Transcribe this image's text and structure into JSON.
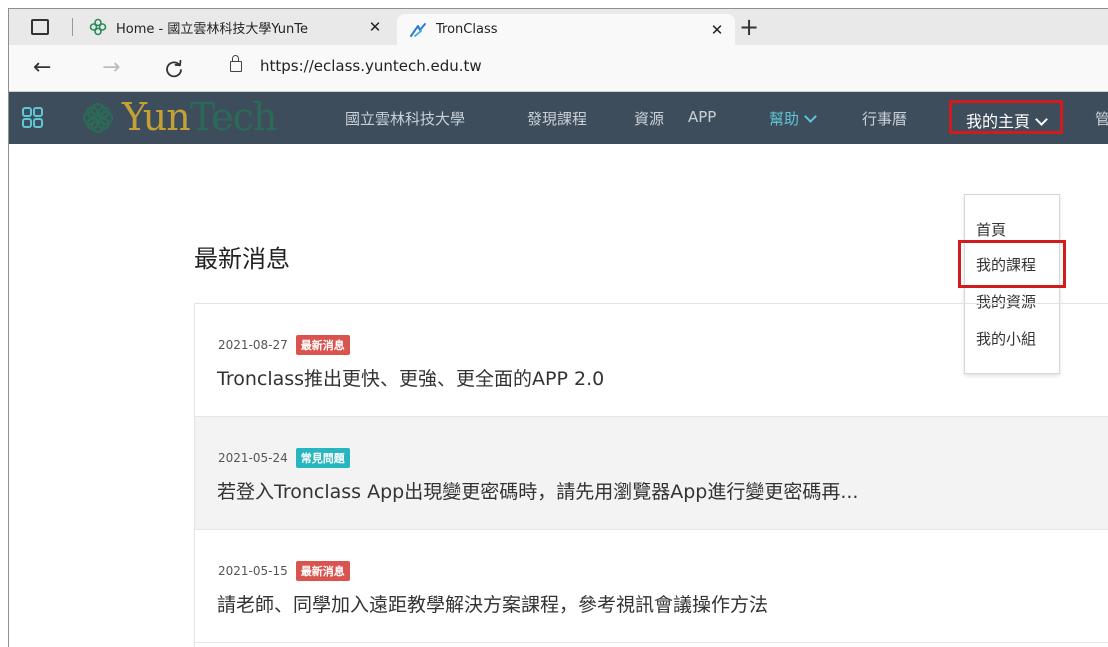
{
  "browser": {
    "tabs": [
      {
        "title": "Home - 國立雲林科技大學YunTe",
        "close": "✕"
      },
      {
        "title": "TronClass",
        "close": "✕"
      }
    ],
    "new_tab": "+",
    "url": "https://eclass.yuntech.edu.tw",
    "icons": {
      "back": "←",
      "forward": "→",
      "reload": "C"
    }
  },
  "site": {
    "logo_yun": "Yun",
    "logo_tech": "Tech",
    "nav": {
      "school": "國立雲林科技大學",
      "discover": "發現課程",
      "resources": "資源",
      "app": "APP",
      "help": "幫助",
      "calendar": "行事曆",
      "my_home": "我的主頁",
      "manage": "管"
    },
    "dropdown": [
      "首頁",
      "我的課程",
      "我的資源",
      "我的小組"
    ],
    "colors": {
      "navbar": "#3e4d5c",
      "accent": "#5ec7d6",
      "highlight": "#d01c1c"
    }
  },
  "news": {
    "heading": "最新消息",
    "items": [
      {
        "date": "2021-08-27",
        "badge": "最新消息",
        "badge_color": "#d9534f",
        "title": "Tronclass推出更快、更強、更全面的APP 2.0"
      },
      {
        "date": "2021-05-24",
        "badge": "常見問題",
        "badge_color": "#27b5c0",
        "title": "若登入Tronclass App出現變更密碼時，請先用瀏覽器App進行變更密碼再..."
      },
      {
        "date": "2021-05-15",
        "badge": "最新消息",
        "badge_color": "#d9534f",
        "title": "請老師、同學加入遠距教學解決方案課程，參考視訊會議操作方法"
      }
    ]
  }
}
